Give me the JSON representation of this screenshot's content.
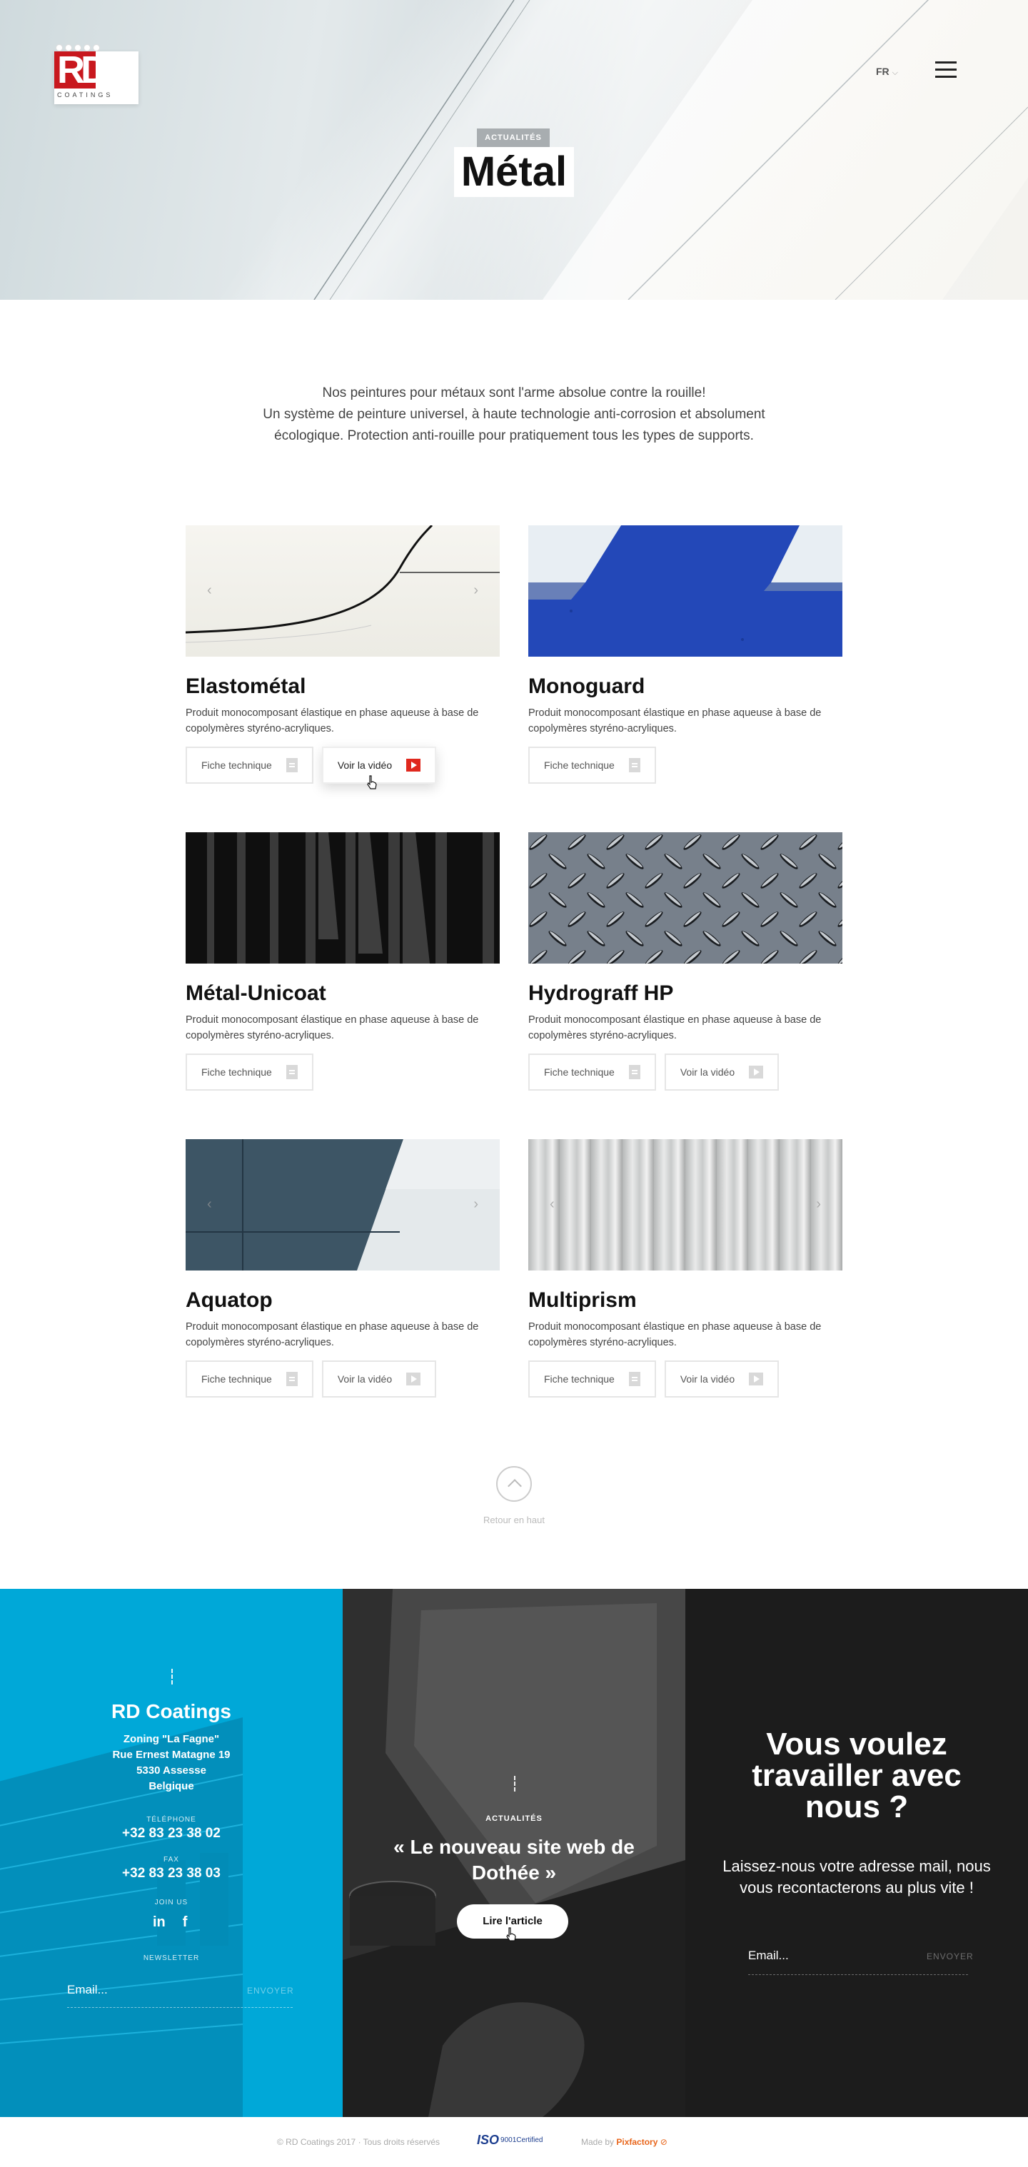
{
  "header": {
    "logo_text": "RD",
    "logo_sub": "COATINGS",
    "lang": "FR",
    "menu_icon": "hamburger-icon",
    "tag": "ACTUALITÉS",
    "title": "Métal"
  },
  "intro": {
    "line1": "Nos peintures pour métaux sont l'arme absolue contre la rouille!",
    "line2": "Un système de peinture universel, à haute technologie anti-corrosion et absolument écologique. Protection anti-rouille pour pratiquement tous les types de supports."
  },
  "products": [
    {
      "name": "Elastométal",
      "desc": "Produit monocomposant élastique en phase aqueuse à base de copolymères styréno-acryliques.",
      "sheet_label": "Fiche technique",
      "video_label": "Voir la vidéo"
    },
    {
      "name": "Monoguard",
      "desc": "Produit monocomposant élastique en phase aqueuse à base de copolymères styréno-acryliques.",
      "sheet_label": "Fiche technique"
    },
    {
      "name": "Métal-Unicoat",
      "desc": "Produit monocomposant élastique en phase aqueuse à base de copolymères styréno-acryliques.",
      "sheet_label": "Fiche technique"
    },
    {
      "name": "Hydrograff HP",
      "desc": "Produit monocomposant élastique en phase aqueuse à base de copolymères styréno-acryliques.",
      "sheet_label": "Fiche technique",
      "video_label": "Voir la vidéo"
    },
    {
      "name": "Aquatop",
      "desc": "Produit monocomposant élastique en phase aqueuse à base de copolymères styréno-acryliques.",
      "sheet_label": "Fiche technique",
      "video_label": "Voir la vidéo"
    },
    {
      "name": "Multiprism",
      "desc": "Produit monocomposant élastique en phase aqueuse à base de copolymères styréno-acryliques.",
      "sheet_label": "Fiche technique",
      "video_label": "Voir la vidéo"
    }
  ],
  "back_to_top": "Retour en haut",
  "contact": {
    "company": "RD Coatings",
    "address": [
      "Zoning \"La Fagne\"",
      "Rue Ernest Matagne 19",
      "5330 Assesse",
      "Belgique"
    ],
    "phone_label": "TÉLÉPHONE",
    "phone": "+32 83 23 38 02",
    "fax_label": "FAX",
    "fax": "+32 83 23 38 03",
    "join_label": "JOIN US",
    "newsletter_label": "NEWSLETTER",
    "email_placeholder": "Email...",
    "send_label": "ENVOYER"
  },
  "news": {
    "tag": "ACTUALITÉS",
    "title": "« Le nouveau site web de Dothée »",
    "button": "Lire l'article"
  },
  "jobs": {
    "title": "Vous voulez travailler avec nous ?",
    "subtitle": "Laissez-nous votre adresse mail, nous vous recontacterons au plus vite !",
    "email_placeholder": "Email...",
    "send_label": "ENVOYER"
  },
  "footer": {
    "copyright": "© RD Coatings 2017 · Tous droits réservés",
    "iso_mark": "ISO",
    "iso_text": "9001Certified",
    "made_by": "Made by",
    "agency": "Pixfactory"
  },
  "colors": {
    "accent_blue": "#00a8d8",
    "dark_panel": "#1c1c1c",
    "brand_red": "#c8181e",
    "video_red": "#e0281e",
    "pixfactory_orange": "#e8661c"
  }
}
